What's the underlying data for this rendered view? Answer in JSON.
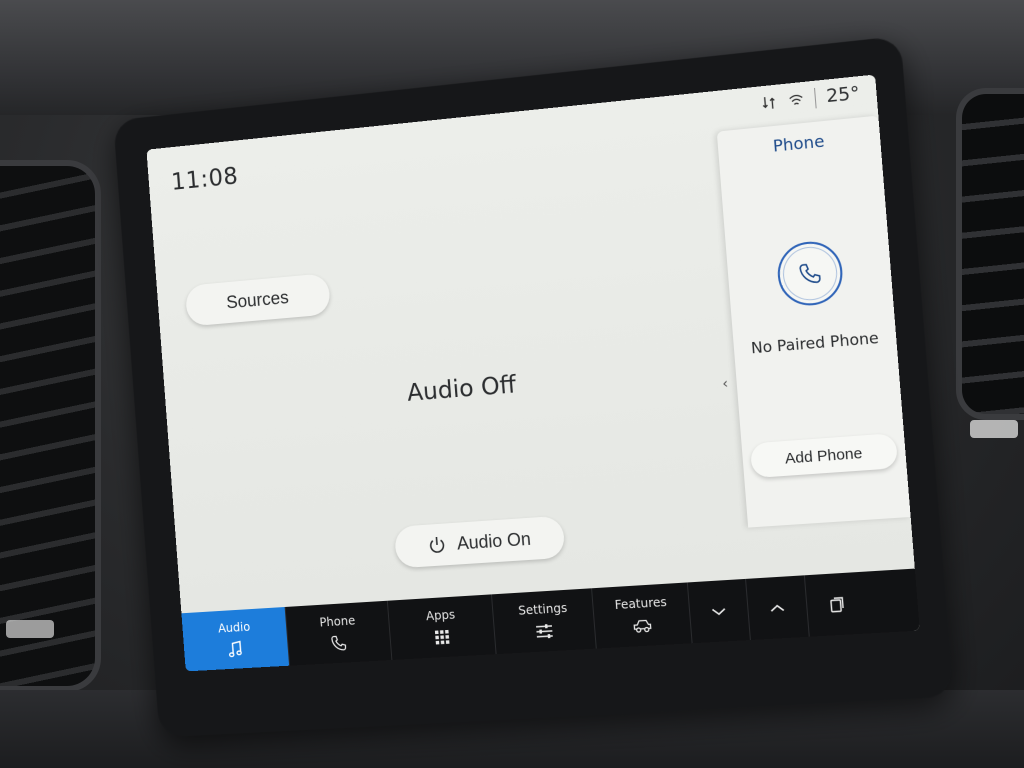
{
  "status_bar": {
    "time": "11:08",
    "temperature": "25°"
  },
  "main": {
    "sources_label": "Sources",
    "audio_status": "Audio Off",
    "audio_on_label": "Audio On",
    "collapse_glyph": "‹"
  },
  "phone_panel": {
    "title": "Phone",
    "status": "No Paired Phone",
    "add_label": "Add Phone"
  },
  "nav": {
    "items": [
      {
        "label": "Audio",
        "icon": "music-note-icon",
        "active": true
      },
      {
        "label": "Phone",
        "icon": "phone-icon"
      },
      {
        "label": "Apps",
        "icon": "grid-icon"
      },
      {
        "label": "Settings",
        "icon": "sliders-icon"
      },
      {
        "label": "Features",
        "icon": "vehicle-icon"
      }
    ],
    "controls": [
      {
        "icon": "chevron-down-icon"
      },
      {
        "icon": "chevron-up-icon"
      },
      {
        "icon": "window-stack-icon"
      }
    ]
  },
  "colors": {
    "accent": "#1d7ddb",
    "phone_title": "#1d4a8a",
    "navbar": "#111214"
  }
}
